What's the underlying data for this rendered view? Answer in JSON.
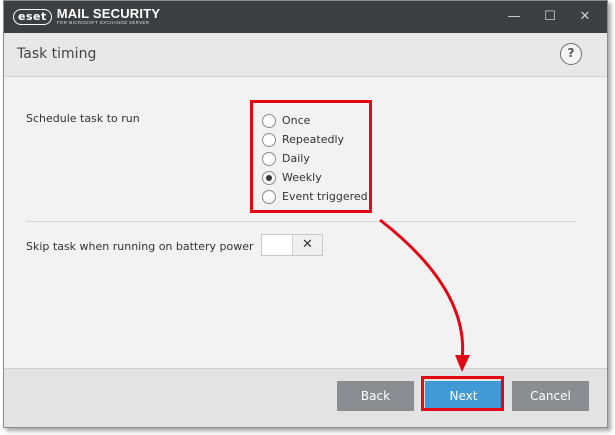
{
  "app": {
    "brand": "eset",
    "product_name": "MAIL SECURITY",
    "product_subtitle": "FOR MICROSOFT EXCHANGE SERVER"
  },
  "window_controls": {
    "minimize": "—",
    "maximize": "☐",
    "close": "✕"
  },
  "header": {
    "title": "Task timing",
    "help": "?"
  },
  "schedule": {
    "label": "Schedule task to run",
    "options": [
      {
        "label": "Once",
        "selected": false
      },
      {
        "label": "Repeatedly",
        "selected": false
      },
      {
        "label": "Daily",
        "selected": false
      },
      {
        "label": "Weekly",
        "selected": true
      },
      {
        "label": "Event triggered",
        "selected": false
      }
    ]
  },
  "battery": {
    "label": "Skip task when running on battery power",
    "toggle_symbol": "✕",
    "enabled": false
  },
  "footer": {
    "back_label": "Back",
    "next_label": "Next",
    "cancel_label": "Cancel"
  },
  "colors": {
    "titlebar": "#3b3f42",
    "primary_button": "#3f9ad6",
    "secondary_button": "#8a8e92",
    "annotation": "#e30613"
  }
}
